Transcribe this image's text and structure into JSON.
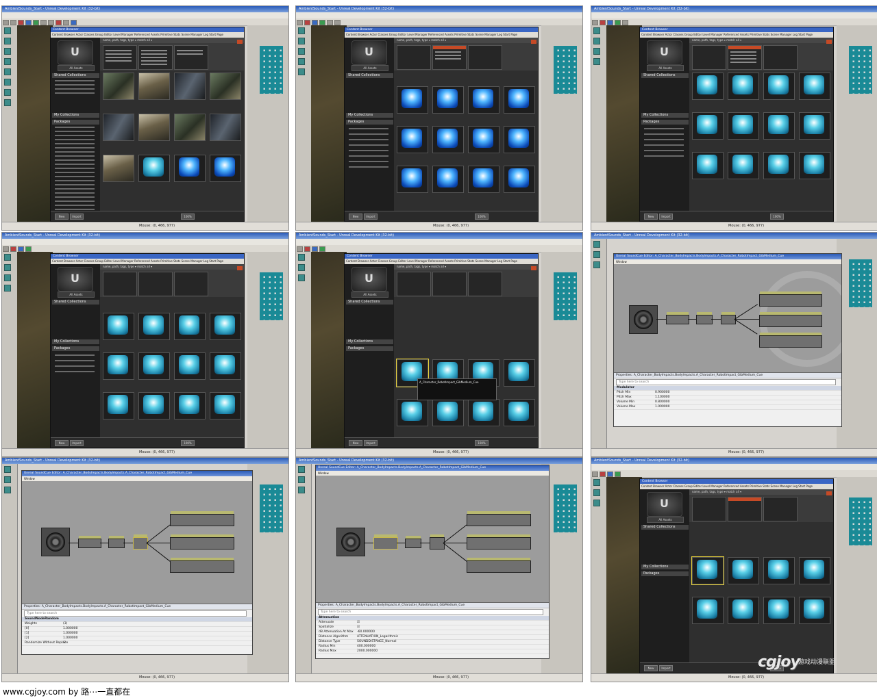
{
  "footer": {
    "caption": "www.cgjoy.com by 路⋯一直都在",
    "logo": "cgjoy",
    "logo_tagline": "游戏动漫联盟"
  },
  "editor": {
    "title": "AmbientSounds_Start - Unreal Development Kit (32-bit)",
    "status": "Mouse: (0, 466, 977)"
  },
  "content_browser": {
    "title": "Content Browser",
    "tabs": "Content Browser  Actor Classes  Group Editor  Level Manager  Referenced Assets  Primitive Stats  Scene Manager  Log  Start Page",
    "all_assets": "All Assets",
    "shared_collections": "Shared Collections",
    "my_collections": "My Collections",
    "packages": "Packages",
    "filter_text": "name, path, tags, type  ▾   match all ▾",
    "items_count": "4302 items (1 selected)",
    "object_type_header": "Object Type",
    "new_button": "New",
    "import_button": "Import",
    "zoom": "100%"
  },
  "tooltip_name": "A_Character_RobotImpact_GibMedium_Cue",
  "cue_editor": {
    "title": "Unreal SoundCue Editor: A_Character_BodyImpacts.BodyImpacts.A_Character_RobotImpact_GibMedium_Cue",
    "menu": "Window",
    "properties_title": "Properties: A_Character_BodyImpacts.BodyImpacts.A_Character_RobotImpact_GibMedium_Cue",
    "search_placeholder": "Type here to search",
    "modulator": {
      "category": "Modulator",
      "rows": [
        {
          "name": "Pitch Min",
          "value": "0.900000"
        },
        {
          "name": "Pitch Max",
          "value": "1.100000"
        },
        {
          "name": "Volume Min",
          "value": "0.800000"
        },
        {
          "name": "Volume Max",
          "value": "1.000000"
        }
      ]
    },
    "random": {
      "category": "SoundNodeRandom",
      "rows": [
        {
          "name": "Weights",
          "value": "(3)"
        },
        {
          "name": "[0]",
          "value": "1.000000"
        },
        {
          "name": "[1]",
          "value": "1.000000"
        },
        {
          "name": "[2]",
          "value": "1.000000"
        },
        {
          "name": "Randomize Without Replace",
          "value": "☑"
        }
      ]
    },
    "attenuation": {
      "category": "Attenuation",
      "rows": [
        {
          "name": "Attenuate",
          "value": "☑"
        },
        {
          "name": "Spatialize",
          "value": "☑"
        },
        {
          "name": "dB Attenuation At Max",
          "value": "-60.000000"
        },
        {
          "name": "Distance Algorithm",
          "value": "ATTENUATION_Logarithmic"
        },
        {
          "name": "Distance Type",
          "value": "SOUNDDISTANCE_Normal"
        },
        {
          "name": "Radius Min",
          "value": "400.000000"
        },
        {
          "name": "Radius Max",
          "value": "2000.000000"
        }
      ]
    }
  },
  "colors": {
    "accent_orange": "#c64a26",
    "title_blue": "#2a5bb8",
    "teal_tools": "#1a8a96",
    "selection_yellow": "#e8d23a"
  }
}
